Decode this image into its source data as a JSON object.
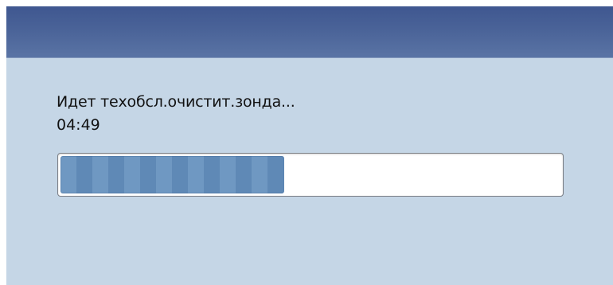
{
  "dialog": {
    "message": "Идет техобсл.очистит.зонда...",
    "remaining_time": "04:49"
  },
  "progress": {
    "fraction": 0.448
  },
  "colors": {
    "title_bar": "#4a6398",
    "background": "#c5d6e6",
    "progress_fill": "#6f98c2",
    "track": "#ffffff"
  }
}
